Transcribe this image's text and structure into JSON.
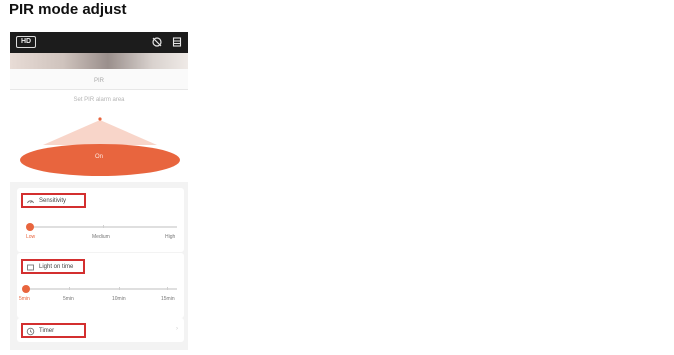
{
  "page_title": "PIR mode adjust",
  "topbar": {
    "hd_badge": "HD",
    "icons": [
      "no-motion-icon",
      "sd-card-icon"
    ]
  },
  "screen_title": "PIR",
  "pir": {
    "prompt": "Set PIR alarm area",
    "toggle_label": "On",
    "accent_color": "#e8653e"
  },
  "sensitivity": {
    "label": "Sensitivity",
    "icon": "sensitivity-icon",
    "levels": [
      "Low",
      "Medium",
      "High"
    ],
    "selected": "Low"
  },
  "light_on_time": {
    "label": "Light on time",
    "icon": "light-icon",
    "levels": [
      "5min",
      "5min",
      "10min",
      "15min"
    ],
    "selected_index": 0
  },
  "timer": {
    "label": "Timer",
    "icon": "clock-icon"
  },
  "highlight_color": "#d32f2f"
}
